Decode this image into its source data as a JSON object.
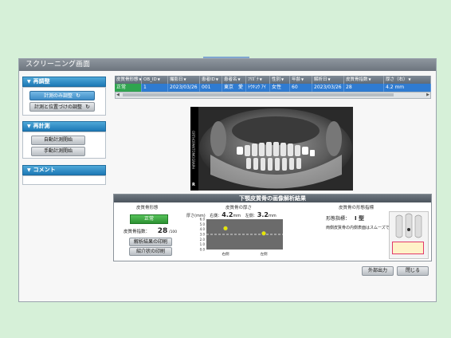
{
  "window": {
    "title": "スクリーニング画面"
  },
  "left": {
    "readjust": {
      "header": "再調整",
      "btn_measure_only": "計測のみ調整",
      "btn_measure_position": "計測と位置づけの調整"
    },
    "remeasure": {
      "header": "再計測",
      "btn_auto": "自動計測開始",
      "btn_manual": "手動計測開始"
    },
    "comment": {
      "header": "コメント"
    }
  },
  "table": {
    "columns": [
      "皮質骨形態",
      "OB_ID",
      "撮影日",
      "患者ID",
      "患者名",
      "ﾌﾘｶﾞﾅ",
      "性別",
      "年齢",
      "解析日",
      "皮質骨指数",
      "厚さ（右）"
    ],
    "row": [
      "正常",
      "1",
      "2023/03/26",
      "001",
      "東京　愛",
      "ﾄｳｷｮｳ ｱｲ",
      "女性",
      "60",
      "2023/03/26",
      "28",
      "4.2 mm"
    ]
  },
  "xray": {
    "side_text": "ORTHOPANTOMOGRAPH",
    "marker": "R"
  },
  "results": {
    "title": "下顎皮質骨の画像解析結果",
    "morph": {
      "label": "皮質骨形態",
      "status": "正常",
      "index_label": "皮質骨指数：",
      "index_value": "28",
      "index_max": "/100",
      "btn_print_results": "解析結果の印刷",
      "btn_print_referral": "紹介状の印刷"
    },
    "thickness": {
      "label": "皮質骨の厚さ",
      "axis_label": "厚さ(mm)",
      "right_label": "右側：",
      "right_value": "4.2",
      "left_label": "左側：",
      "left_value": "3.2",
      "unit": "mm",
      "x_right": "右側",
      "x_left": "左側"
    },
    "shape": {
      "label": "皮質骨の形態指標",
      "grade_label": "形態指標：",
      "grade_value": "I 型",
      "description": "両側皮質骨の内側表面はスムーズです。"
    }
  },
  "chart_data": {
    "type": "scatter",
    "ylabel": "厚さ(mm)",
    "ylim": [
      0,
      6
    ],
    "yticks": [
      "6.0",
      "5.0",
      "4.0",
      "3.0",
      "2.0",
      "1.0",
      "0.0"
    ],
    "categories": [
      "右側",
      "左側"
    ],
    "values": [
      4.2,
      3.2
    ],
    "threshold": 3.0
  },
  "footer": {
    "btn_export": "外部出力",
    "btn_close": "閉じる"
  },
  "colors": {
    "accent_blue": "#2f7bd1",
    "status_green": "#2fa44f",
    "point_yellow": "#e6e600"
  }
}
